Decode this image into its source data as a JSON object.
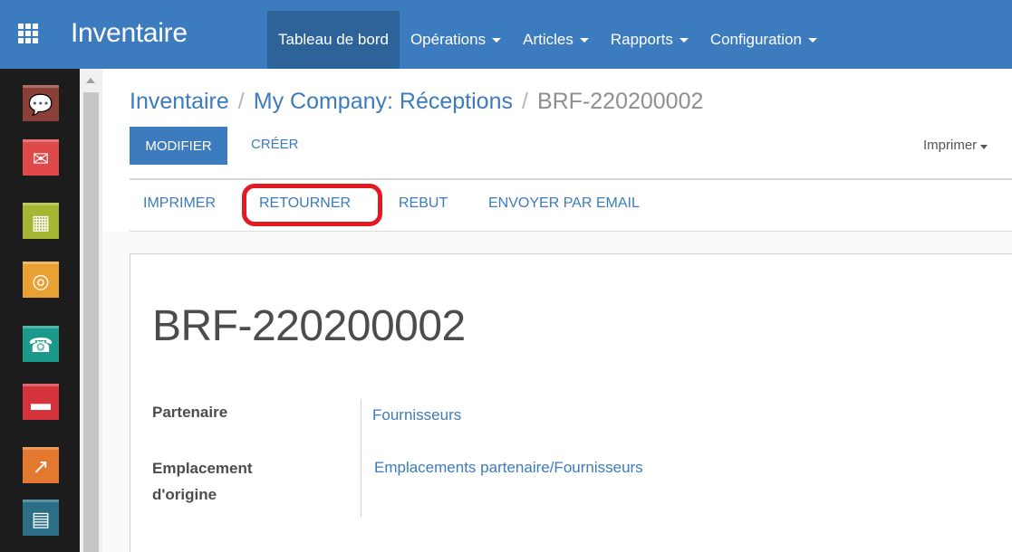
{
  "topbar": {
    "app_title": "Inventaire",
    "menu": [
      {
        "label": "Tableau de bord",
        "active": true,
        "dropdown": false
      },
      {
        "label": "Opérations",
        "active": false,
        "dropdown": true
      },
      {
        "label": "Articles",
        "active": false,
        "dropdown": true
      },
      {
        "label": "Rapports",
        "active": false,
        "dropdown": true
      },
      {
        "label": "Configuration",
        "active": false,
        "dropdown": true
      }
    ],
    "color": "#3c7bbd"
  },
  "app_switcher": {
    "icons": [
      {
        "name": "discuss-icon",
        "color": "#8a3f39",
        "glyph": "💬"
      },
      {
        "name": "email-marketing-icon",
        "color": "#e0494a",
        "glyph": "✉"
      },
      {
        "name": "calendar-icon",
        "color": "#a6b532",
        "glyph": "▦"
      },
      {
        "name": "crm-icon",
        "color": "#e9a134",
        "glyph": "◎"
      },
      {
        "name": "contacts-icon",
        "color": "#1b9a8c",
        "glyph": "☎"
      },
      {
        "name": "documents-icon",
        "color": "#d6343d",
        "glyph": "▬"
      },
      {
        "name": "reporting-icon",
        "color": "#e3792f",
        "glyph": "↗"
      },
      {
        "name": "spreadsheet-icon",
        "color": "#2a6f85",
        "glyph": "▤"
      }
    ]
  },
  "breadcrumb": {
    "items": [
      "Inventaire",
      "My Company: Réceptions"
    ],
    "current": "BRF-220200002",
    "separator": "/"
  },
  "controls": {
    "edit_label": "MODIFIER",
    "create_label": "CRÉER",
    "print_dropdown_label": "Imprimer"
  },
  "statusbar": {
    "buttons": [
      "IMPRIMER",
      "RETOURNER",
      "REBUT",
      "ENVOYER PAR EMAIL"
    ],
    "highlighted": "RETOURNER",
    "highlight_color": "#e41a23"
  },
  "record": {
    "title": "BRF-220200002",
    "fields": [
      {
        "label_lines": [
          "Partenaire"
        ],
        "value": "Fournisseurs"
      },
      {
        "label_lines": [
          "Emplacement",
          "d'origine"
        ],
        "value": "Emplacements partenaire/Fournisseurs"
      }
    ]
  }
}
